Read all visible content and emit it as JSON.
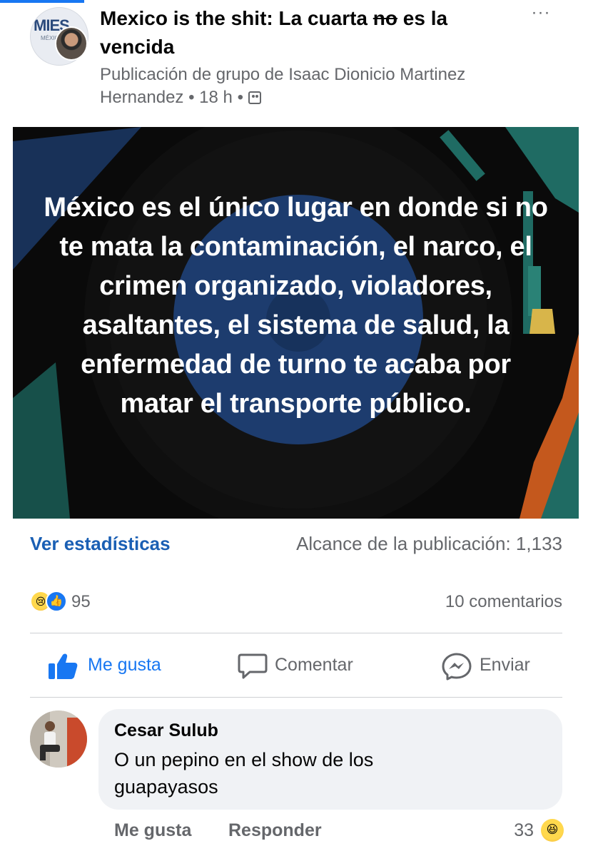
{
  "post": {
    "title_before": "Mexico is the shit: La cuarta ",
    "title_strike": "no",
    "title_after": " es la vencida",
    "meta_author_line": "Publicación de grupo de Isaac Dionicio Martinez",
    "meta_author_line2": "Hernandez",
    "meta_time": "18 h",
    "meta_sep": "•",
    "more_icon": "···",
    "group_logo": "MIES",
    "group_logo_sub": "MÉXIC",
    "group_privacy_icon": "group-icon"
  },
  "image": {
    "text": "México es el único lugar en donde si no te mata la contaminación, el narco, el crimen organizado, violadores, asaltantes, el sistema de salud, la enfermedad de turno te acaba por matar el transporte público.",
    "colors": {
      "background": "#0a0a0a",
      "disc": "#1d3c6e",
      "accent_teal": "#1f6b63",
      "accent_orange": "#c4581d"
    }
  },
  "stats": {
    "link": "Ver estadísticas",
    "reach": "Alcance de la publicación: 1,133"
  },
  "reactions": {
    "count": "95",
    "icons": [
      "sad-reaction-icon",
      "like-reaction-icon"
    ],
    "comments": "10 comentarios"
  },
  "actions": {
    "like": "Me gusta",
    "comment": "Comentar",
    "send": "Enviar"
  },
  "comment": {
    "author": "Cesar Sulub",
    "text": "O un pepino en el show de los guapayasos",
    "like": "Me gusta",
    "reply": "Responder",
    "reaction_count": "33",
    "reaction_icon": "haha-reaction-icon"
  },
  "colors": {
    "accent": "#1877f2",
    "link": "#1a5fb4",
    "secondary_text": "#65676b",
    "bubble": "#f0f2f5"
  }
}
